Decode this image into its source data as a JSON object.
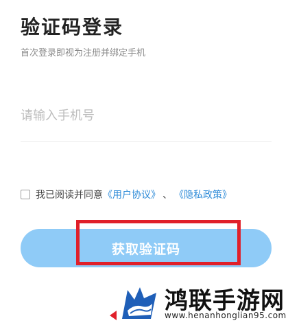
{
  "title": "验证码登录",
  "subtitle": "首次登录即视为注册并绑定手机",
  "phone_input": {
    "placeholder": "请输入手机号",
    "value": ""
  },
  "agreement": {
    "checked": false,
    "prefix": "我已阅读并同意",
    "user_agreement": "《用户协议》",
    "separator": "、",
    "privacy_policy": "《隐私政策》"
  },
  "get_code_button": {
    "label": "获取验证码",
    "color": "#8fcbf7"
  },
  "highlight": {
    "color": "#e0202a"
  },
  "watermark": {
    "name": "鸿联手游网",
    "url": "www.henanhonglian95.com",
    "logo_icon": "rhino-logo"
  },
  "colors": {
    "link": "#2e8bd8",
    "accent_red": "#e0202a"
  }
}
